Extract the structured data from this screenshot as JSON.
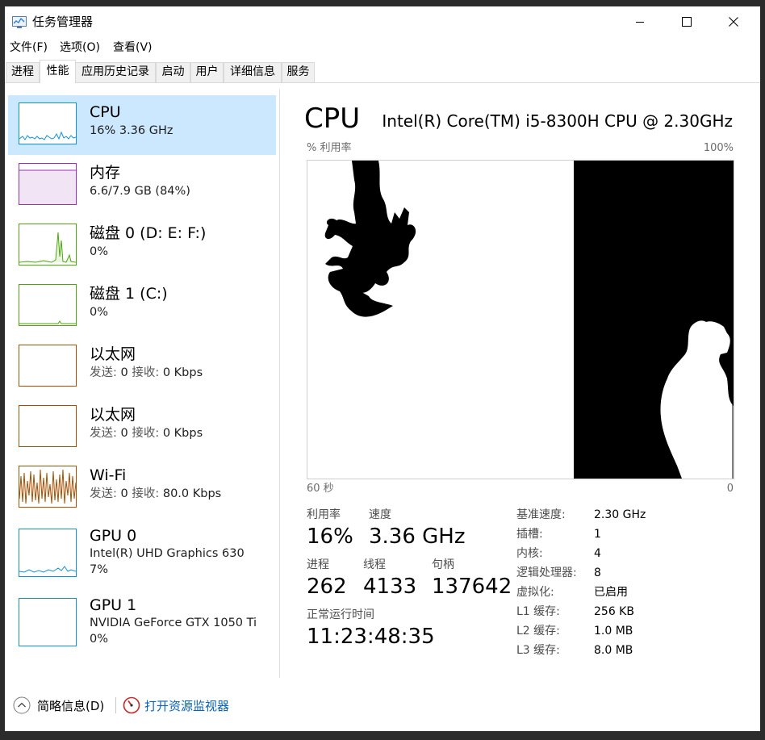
{
  "window": {
    "title": "任务管理器"
  },
  "menu": [
    "文件(F)",
    "选项(O)",
    "查看(V)"
  ],
  "tabs": [
    "进程",
    "性能",
    "应用历史记录",
    "启动",
    "用户",
    "详细信息",
    "服务"
  ],
  "sidebar": [
    {
      "name": "CPU",
      "sub": "16% 3.36 GHz",
      "color": "#1190d8"
    },
    {
      "name": "内存",
      "sub": "6.6/7.9 GB (84%)",
      "color": "#9d30b9"
    },
    {
      "name": "磁盘 0 (D: E: F:)",
      "sub": "0%",
      "color": "#4da60c"
    },
    {
      "name": "磁盘 1 (C:)",
      "sub": "0%",
      "color": "#4da60c"
    },
    {
      "name": "以太网",
      "sub_prefix": "发送:",
      "sub_send": "0",
      "sub_mid": "接收:",
      "sub_recv": "0 Kbps",
      "color": "#a74f01"
    },
    {
      "name": "以太网",
      "sub_prefix": "发送:",
      "sub_send": "0",
      "sub_mid": "接收:",
      "sub_recv": "0 Kbps",
      "color": "#a74f01"
    },
    {
      "name": "Wi-Fi",
      "sub_prefix": "发送:",
      "sub_send": "0",
      "sub_mid": "接收:",
      "sub_recv": "80.0 Kbps",
      "color": "#a74f01"
    },
    {
      "name": "GPU 0",
      "sub": "Intel(R) UHD Graphics 630",
      "sub2": "7%",
      "color": "#1190d8"
    },
    {
      "name": "GPU 1",
      "sub": "NVIDIA GeForce GTX 1050 Ti",
      "sub2": "0%",
      "color": "#1190d8"
    }
  ],
  "main": {
    "title": "CPU",
    "model": "Intel(R) Core(TM) i5-8300H CPU @ 2.30GHz",
    "graph_ylabel": "% 利用率",
    "graph_ymax": "100%",
    "graph_xlabel": "60 秒",
    "graph_xmin": "0"
  },
  "stats": {
    "utilization_label": "利用率",
    "utilization": "16%",
    "speed_label": "速度",
    "speed": "3.36 GHz",
    "processes_label": "进程",
    "processes": "262",
    "threads_label": "线程",
    "threads": "4133",
    "handles_label": "句柄",
    "handles": "137642",
    "uptime_label": "正常运行时间",
    "uptime": "11:23:48:35"
  },
  "details": [
    {
      "k": "基准速度:",
      "v": "2.30 GHz"
    },
    {
      "k": "插槽:",
      "v": "1"
    },
    {
      "k": "内核:",
      "v": "4"
    },
    {
      "k": "逻辑处理器:",
      "v": "8"
    },
    {
      "k": "虚拟化:",
      "v": "已启用"
    },
    {
      "k": "L1 缓存:",
      "v": "256 KB"
    },
    {
      "k": "L2 缓存:",
      "v": "1.0 MB"
    },
    {
      "k": "L3 缓存:",
      "v": "8.0 MB"
    }
  ],
  "footer": {
    "summary": "简略信息(D)",
    "monitor": "打开资源监视器"
  },
  "icons": {
    "app": "task-manager-icon",
    "minimize": "minimize-icon",
    "maximize": "maximize-icon",
    "close": "close-icon",
    "collapse": "chevron-up-icon",
    "monitor": "resource-monitor-icon"
  },
  "colors": {
    "selected": "#cce8ff",
    "link": "#0a62b8"
  }
}
